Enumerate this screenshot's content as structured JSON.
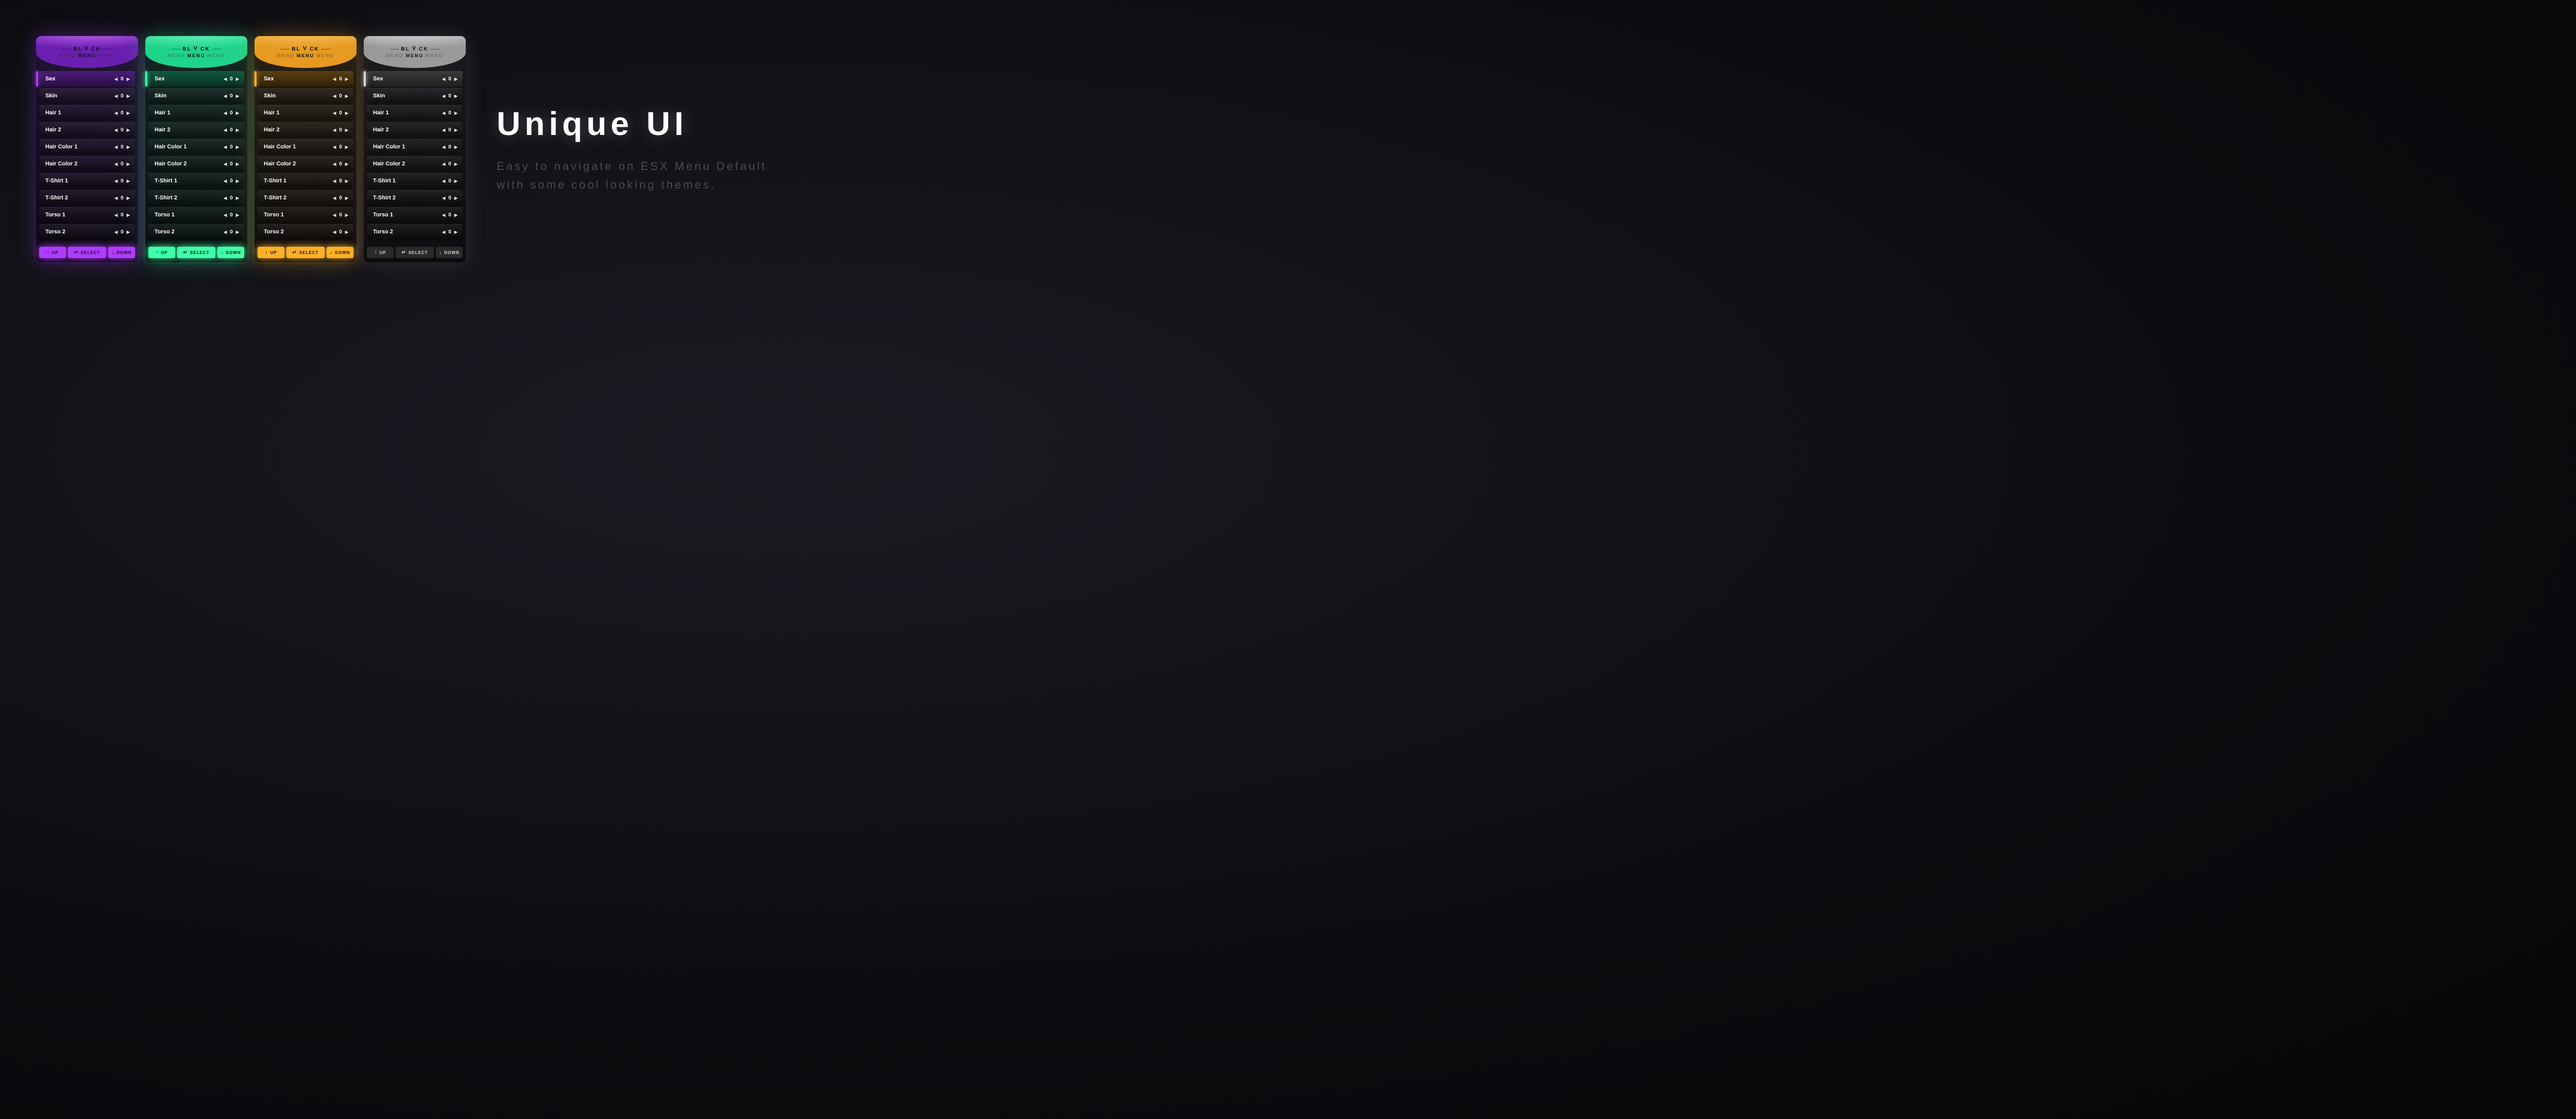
{
  "headline": "Unique UI",
  "subtext": "Easy to navigate on ESX Menu Default with some cool looking themes.",
  "brand": {
    "left": "BL",
    "mid": "V",
    "right": "CK"
  },
  "menu_label": {
    "dim": "MENU",
    "main": "MENU"
  },
  "footer": {
    "up": "UP",
    "select": "SELECT",
    "down": "DOWN"
  },
  "items": [
    {
      "label": "Sex",
      "value": "0",
      "active": true
    },
    {
      "label": "Skin",
      "value": "0",
      "active": false
    },
    {
      "label": "Hair 1",
      "value": "0",
      "active": false
    },
    {
      "label": "Hair 2",
      "value": "0",
      "active": false
    },
    {
      "label": "Hair Color 1",
      "value": "0",
      "active": false
    },
    {
      "label": "Hair Color 2",
      "value": "0",
      "active": false
    },
    {
      "label": "T-Shirt 1",
      "value": "0",
      "active": false
    },
    {
      "label": "T-Shirt 2",
      "value": "0",
      "active": false
    },
    {
      "label": "Torso 1",
      "value": "0",
      "active": false
    },
    {
      "label": "Torso 2",
      "value": "0",
      "active": false
    }
  ],
  "themes": [
    "purple",
    "green",
    "orange",
    "grey"
  ]
}
